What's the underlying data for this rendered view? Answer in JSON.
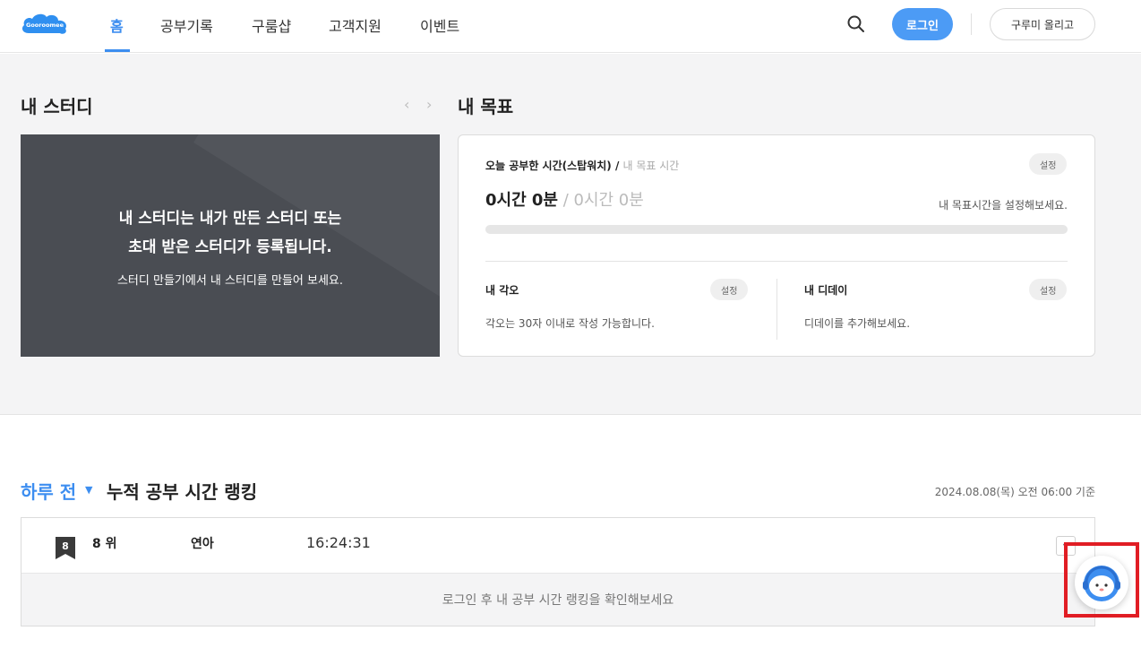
{
  "header": {
    "logo_text": "Gooroomee",
    "nav": [
      {
        "label": "홈",
        "active": true
      },
      {
        "label": "공부기록",
        "active": false
      },
      {
        "label": "구룸샵",
        "active": false
      },
      {
        "label": "고객지원",
        "active": false
      },
      {
        "label": "이벤트",
        "active": false
      }
    ],
    "search_icon": "search-icon",
    "login_label": "로그인",
    "upload_label": "구루미 올리고"
  },
  "my_study": {
    "title": "내 스터디",
    "line1": "내 스터디는 내가 만든 스터디 또는",
    "line2": "초대 받은 스터디가 등록됩니다.",
    "sub": "스터디 만들기에서 내 스터디를 만들어 보세요."
  },
  "my_goal": {
    "title": "내 목표",
    "label_main": "오늘 공부한 시간(스탑워치) / ",
    "label_sub": "내 목표 시간",
    "setting_label": "설정",
    "time_main": "0시간 0분",
    "time_sub": " / 0시간 0분",
    "hint": "내 목표시간을 설정해보세요.",
    "progress_percent": 0,
    "resolve": {
      "title": "내 각오",
      "setting_label": "설정",
      "desc": "각오는 30자 이내로 작성 가능합니다."
    },
    "dday": {
      "title": "내 디데이",
      "setting_label": "설정",
      "desc": "디데이를 추가해보세요."
    }
  },
  "ranking": {
    "period": "하루 전",
    "title": "누적 공부 시간 랭킹",
    "date": "2024.08.08(목) 오전 06:00 기준",
    "row": {
      "badge": "8",
      "place": "8 위",
      "name": "연아",
      "time": "16:24:31"
    },
    "footer": "로그인 후 내 공부 시간 랭킹을 확인해보세요"
  },
  "colors": {
    "accent": "#3d8ef0",
    "login_bg": "#4c9bf5",
    "study_card_bg": "#4a4d53",
    "highlight": "#e11d24"
  }
}
